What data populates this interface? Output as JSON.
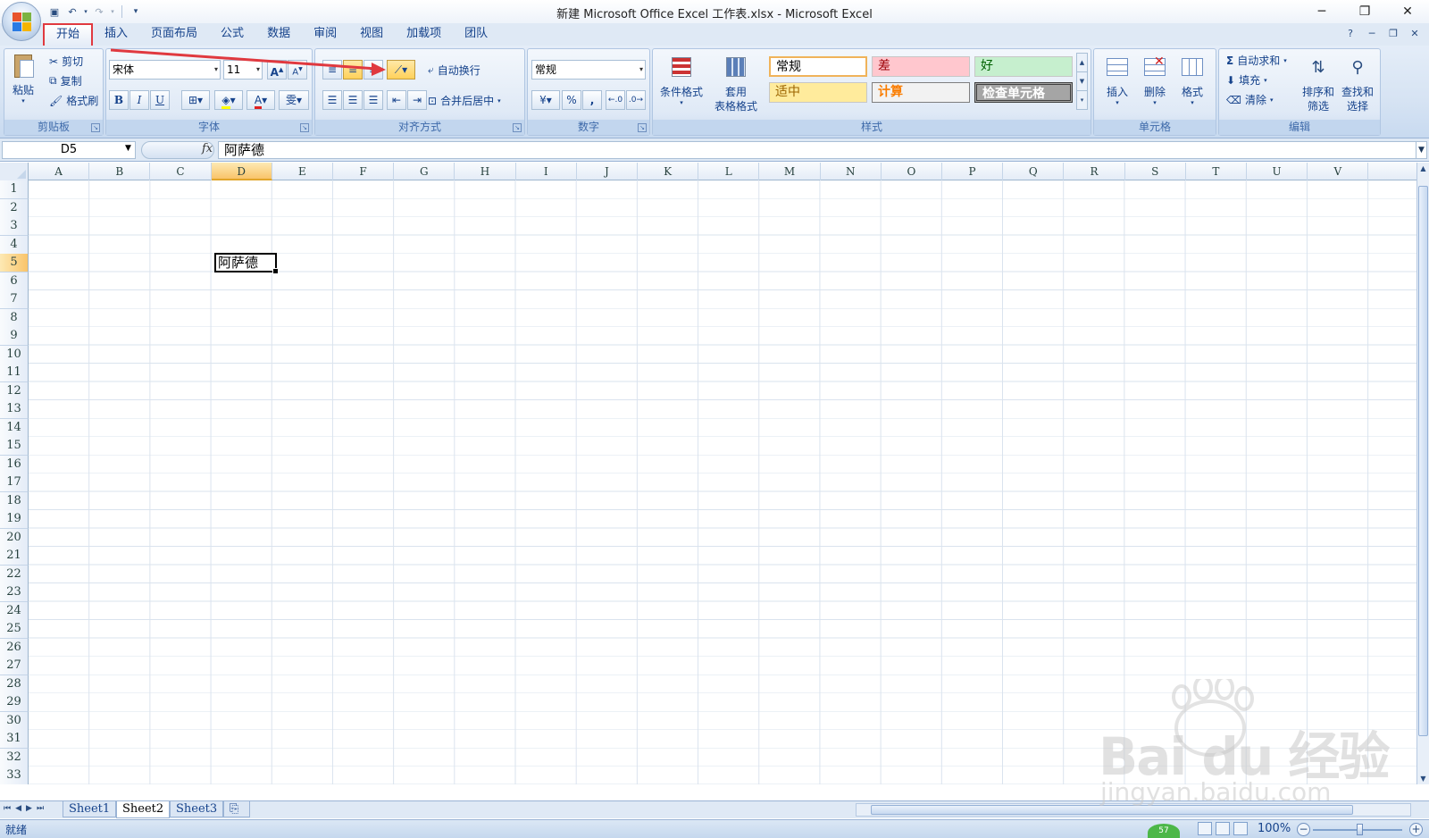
{
  "window": {
    "title": "新建 Microsoft Office Excel 工作表.xlsx - Microsoft Excel"
  },
  "tabs": [
    "开始",
    "插入",
    "页面布局",
    "公式",
    "数据",
    "审阅",
    "视图",
    "加载项",
    "团队"
  ],
  "active_tab": "开始",
  "clipboard": {
    "paste": "粘贴",
    "cut": "剪切",
    "copy": "复制",
    "format_painter": "格式刷",
    "group_label": "剪贴板"
  },
  "font": {
    "name": "宋体",
    "size": "11",
    "group_label": "字体"
  },
  "alignment": {
    "wrap_text": "自动换行",
    "merge_center": "合并后居中",
    "group_label": "对齐方式"
  },
  "number": {
    "format": "常规",
    "percent": "%",
    "comma": ",",
    "group_label": "数字"
  },
  "styles": {
    "conditional": "条件格式",
    "table_format_1": "套用",
    "table_format_2": "表格格式",
    "normal": "常规",
    "bad": "差",
    "good": "好",
    "neutral": "适中",
    "calculation": "计算",
    "check_cell": "检查单元格",
    "group_label": "样式"
  },
  "cells": {
    "insert": "插入",
    "delete": "删除",
    "format": "格式",
    "group_label": "单元格"
  },
  "editing": {
    "autosum": "自动求和",
    "fill": "填充",
    "clear": "清除",
    "sort_1": "排序和",
    "sort_2": "筛选",
    "find_1": "查找和",
    "find_2": "选择",
    "group_label": "编辑"
  },
  "formula_bar": {
    "name_box": "D5",
    "fx": "fx",
    "content": "阿萨德"
  },
  "columns": [
    "A",
    "B",
    "C",
    "D",
    "E",
    "F",
    "G",
    "H",
    "I",
    "J",
    "K",
    "L",
    "M",
    "N",
    "O",
    "P",
    "Q",
    "R",
    "S",
    "T",
    "U",
    "V"
  ],
  "rows": [
    "1",
    "2",
    "3",
    "4",
    "5",
    "6",
    "7",
    "8",
    "9",
    "10",
    "11",
    "12",
    "13",
    "14",
    "15",
    "16",
    "17",
    "18",
    "19",
    "20",
    "21",
    "22",
    "23",
    "24",
    "25",
    "26",
    "27",
    "28",
    "29",
    "30",
    "31",
    "32",
    "33"
  ],
  "active_cell": {
    "ref": "D5",
    "value": "阿萨德"
  },
  "sheets": [
    "Sheet1",
    "Sheet2",
    "Sheet3"
  ],
  "active_sheet": "Sheet2",
  "status": {
    "text": "就绪",
    "zoom": "100%",
    "badge": "57"
  },
  "watermark": {
    "brand": "Bai du 经验",
    "url": "jingyan.baidu.com"
  },
  "colors": {
    "highlight_border": "#e0393f",
    "bad_bg": "#ffc7ce",
    "good_bg": "#c6efce",
    "neutral_bg": "#ffeb9c",
    "check_bg": "#a5a5a5"
  }
}
